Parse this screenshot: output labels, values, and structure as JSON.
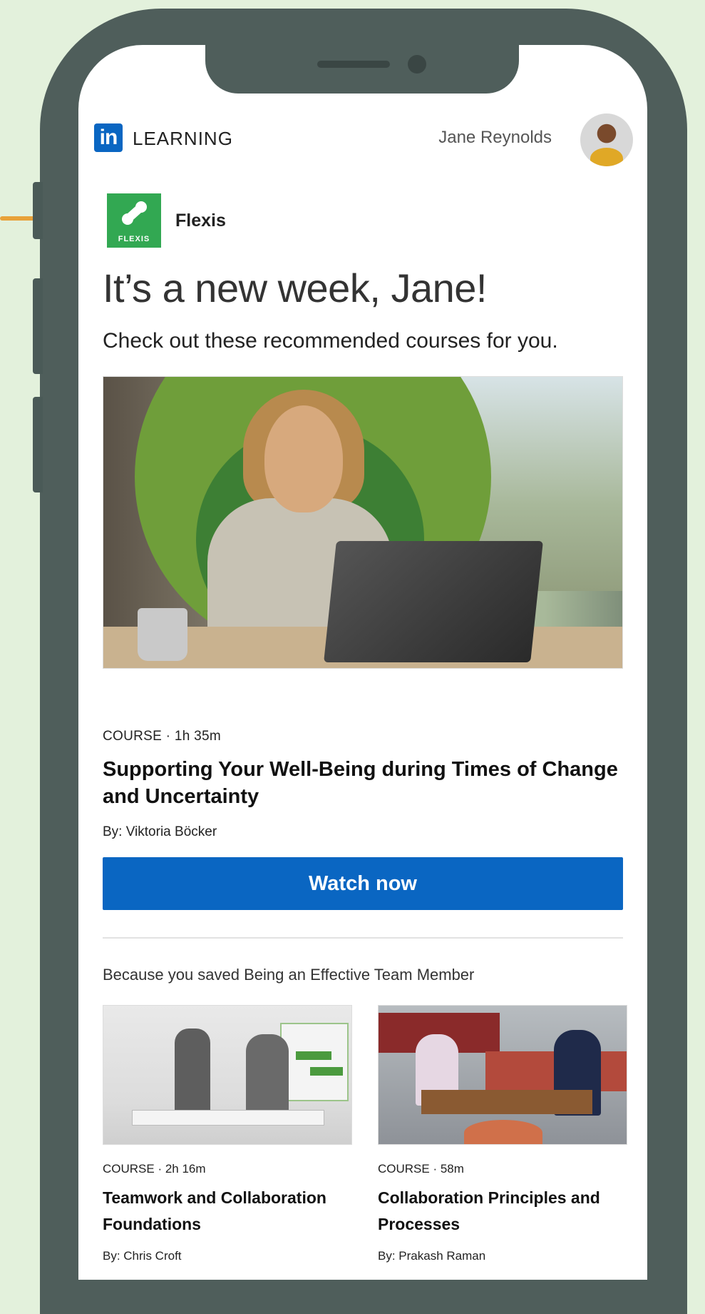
{
  "header": {
    "brand_logo": "in",
    "brand_product": "LEARNING",
    "user_name": "Jane Reynolds"
  },
  "organization": {
    "logo_text": "FLEXIS",
    "name": "Flexis",
    "brand_color": "#32a852"
  },
  "greeting": {
    "title": "It’s a new week, Jane!",
    "subtitle": "Check out these recommended courses for you."
  },
  "featured_course": {
    "meta": "COURSE · 1h 35m",
    "title": "Supporting Your Well-Being during Times of Change and Uncertainty",
    "author": "By: Viktoria Böcker",
    "cta_label": "Watch now",
    "cta_color": "#0a66c2"
  },
  "recommendations": {
    "heading": "Because you saved Being an Effective Team Member",
    "courses": [
      {
        "meta": "COURSE · 2h 16m",
        "title": "Teamwork and Collaboration Foundations",
        "author": "By: Chris Croft"
      },
      {
        "meta": "COURSE · 58m",
        "title": "Collaboration Principles and Processes",
        "author": "By: Prakash Raman"
      }
    ]
  },
  "colors": {
    "background": "#e3f1dc",
    "phone_frame": "#4f5e5b",
    "callout": "#e8a23a"
  }
}
